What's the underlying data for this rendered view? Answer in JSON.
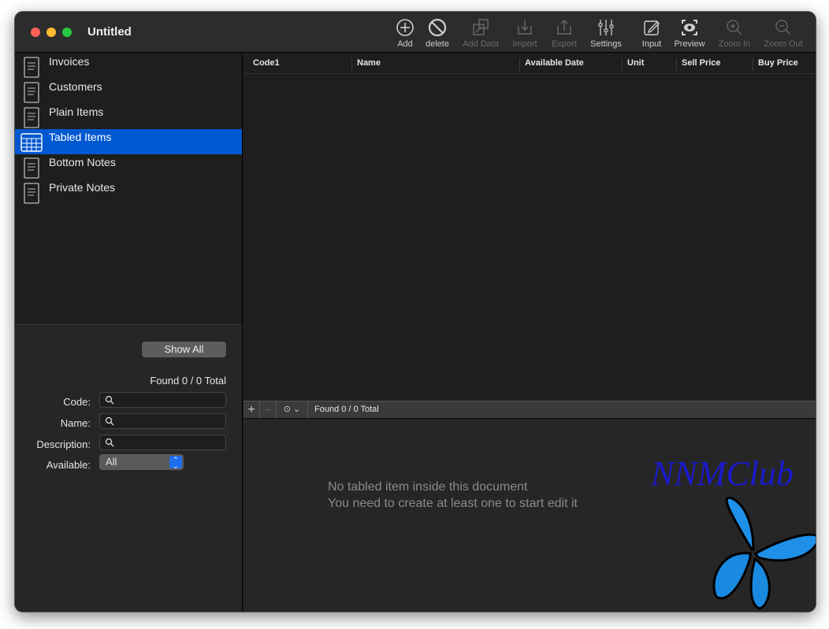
{
  "window": {
    "title": "Untitled"
  },
  "toolbar": [
    {
      "label": "Add",
      "icon": "plus-circle-icon",
      "enabled": true
    },
    {
      "label": "delete",
      "icon": "prohibited-icon",
      "enabled": true
    },
    {
      "label": "Add Data",
      "icon": "add-data-icon",
      "enabled": false
    },
    {
      "label": "Import",
      "icon": "import-icon",
      "enabled": false
    },
    {
      "label": "Export",
      "icon": "export-icon",
      "enabled": false
    },
    {
      "label": "Settings",
      "icon": "sliders-icon",
      "enabled": true
    },
    {
      "label": "Input",
      "icon": "pencil-square-icon",
      "enabled": true
    },
    {
      "label": "Preview",
      "icon": "eye-viewfinder-icon",
      "enabled": true
    },
    {
      "label": "Zoom In",
      "icon": "zoom-in-icon",
      "enabled": false
    },
    {
      "label": "Zoom Out",
      "icon": "zoom-out-icon",
      "enabled": false
    }
  ],
  "sidebar": {
    "items": [
      {
        "label": "Invoices",
        "icon": "invoice-icon"
      },
      {
        "label": "Customers",
        "icon": "customer-icon"
      },
      {
        "label": "Plain Items",
        "icon": "plain-items-icon"
      },
      {
        "label": "Tabled Items",
        "icon": "table-icon",
        "selected": true
      },
      {
        "label": "Bottom Notes",
        "icon": "notes-icon"
      },
      {
        "label": "Private Notes",
        "icon": "private-notes-icon"
      }
    ]
  },
  "filter": {
    "show_all": "Show All",
    "found": "Found 0 / 0 Total",
    "code_label": "Code:",
    "name_label": "Name:",
    "description_label": "Description:",
    "available_label": "Available:",
    "available_value": "All"
  },
  "table": {
    "columns": [
      "Code1",
      "Name",
      "Available Date",
      "Unit",
      "Sell Price",
      "Buy Price"
    ]
  },
  "bottombar": {
    "plus": "+",
    "minus": "−",
    "found": "Found 0 / 0 Total"
  },
  "detail": {
    "empty_line1": "No tabled item inside this document",
    "empty_line2": "You need to create at least one to start edit it"
  },
  "watermark": {
    "text": "NNMClub"
  },
  "colors": {
    "accent": "#0058d0",
    "watermark": "#1a1acc"
  }
}
